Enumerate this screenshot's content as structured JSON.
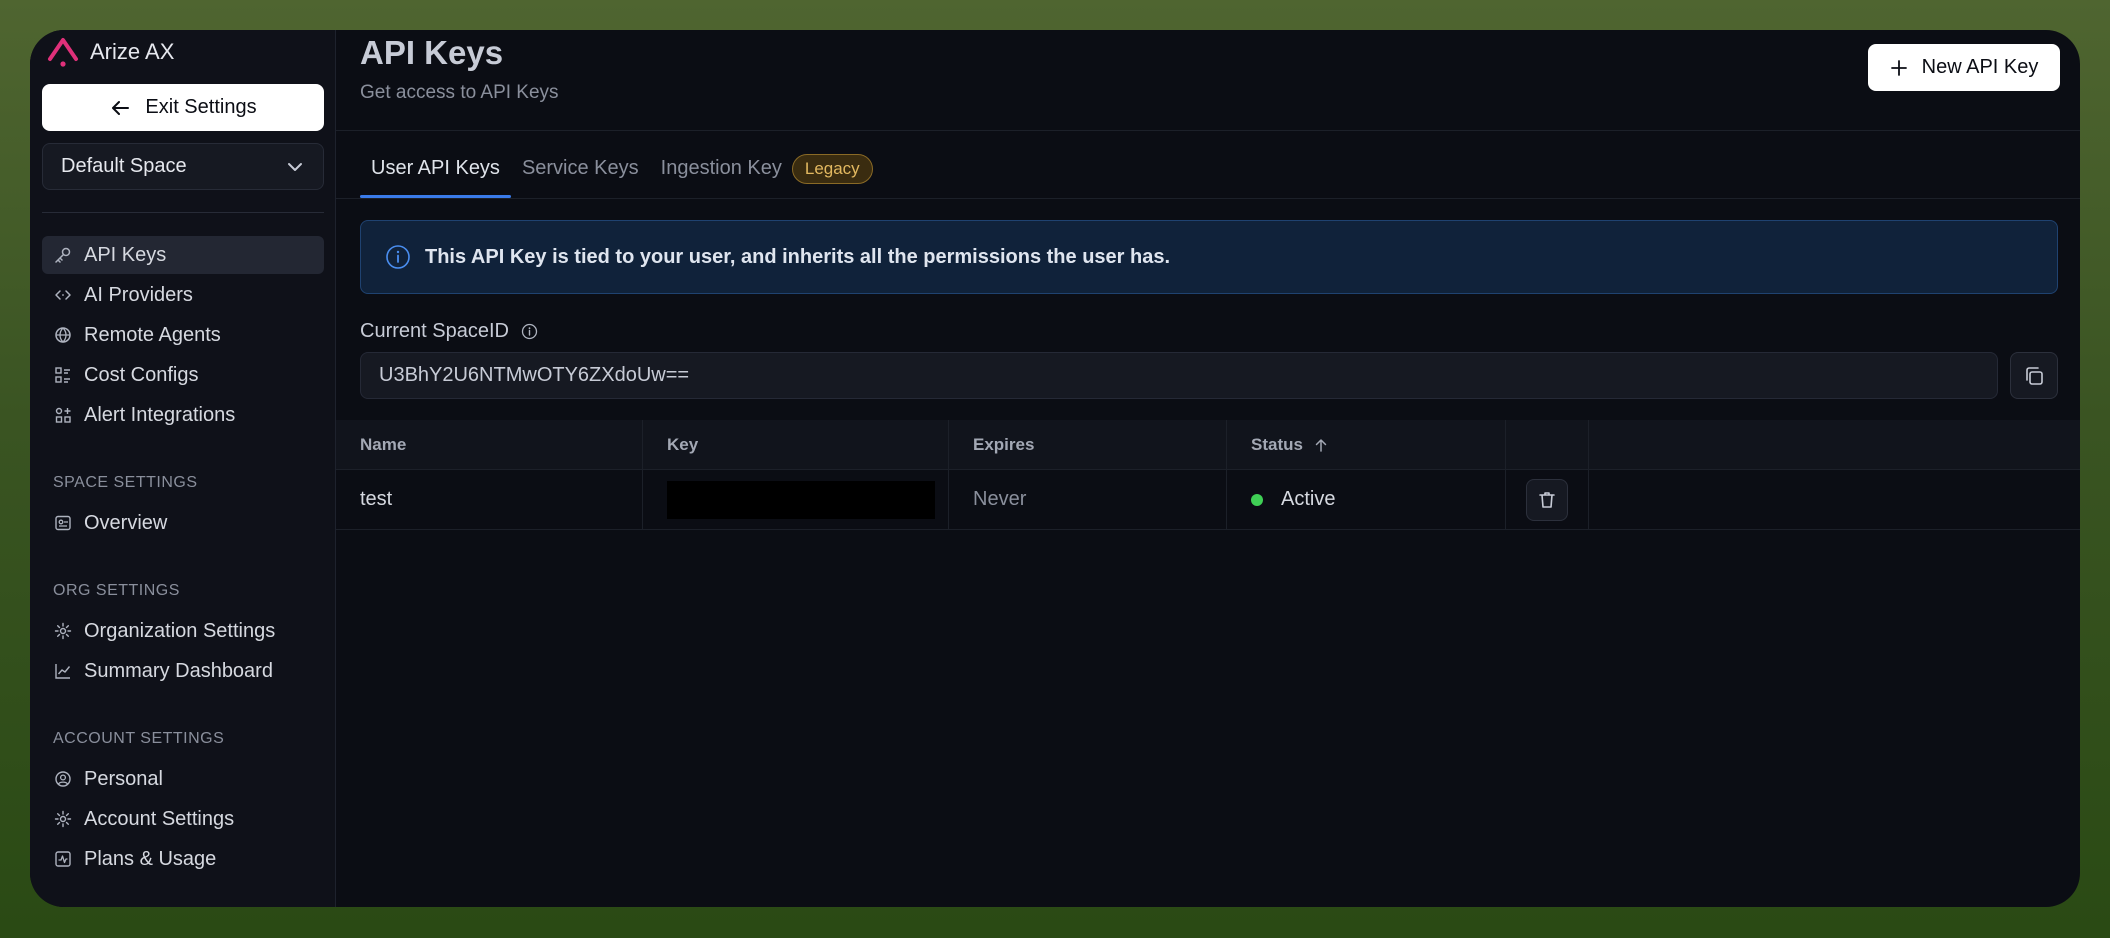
{
  "app": {
    "brand": "Arize AX",
    "brand_color": "#e0307a"
  },
  "sidebar": {
    "exit_label": "Exit Settings",
    "space_select": "Default Space",
    "items": [
      {
        "label": "API Keys",
        "icon": "key-icon",
        "active": true
      },
      {
        "label": "AI Providers",
        "icon": "code-arrows-icon"
      },
      {
        "label": "Remote Agents",
        "icon": "globe-icon"
      },
      {
        "label": "Cost Configs",
        "icon": "list-grid-icon"
      },
      {
        "label": "Alert Integrations",
        "icon": "integrations-icon"
      }
    ],
    "space_settings": {
      "heading": "SPACE SETTINGS",
      "items": [
        {
          "label": "Overview",
          "icon": "overview-icon"
        }
      ]
    },
    "org_settings": {
      "heading": "ORG SETTINGS",
      "items": [
        {
          "label": "Organization Settings",
          "icon": "gear-icon"
        },
        {
          "label": "Summary Dashboard",
          "icon": "chart-line-icon"
        }
      ]
    },
    "account_settings": {
      "heading": "ACCOUNT SETTINGS",
      "items": [
        {
          "label": "Personal",
          "icon": "user-circle-icon"
        },
        {
          "label": "Account Settings",
          "icon": "gear-icon"
        },
        {
          "label": "Plans & Usage",
          "icon": "activity-icon"
        }
      ]
    }
  },
  "main": {
    "title": "API Keys",
    "subtitle": "Get access to API Keys",
    "new_key_label": "New API Key",
    "tabs": [
      {
        "label": "User API Keys",
        "active": true
      },
      {
        "label": "Service Keys"
      },
      {
        "label": "Ingestion Key",
        "badge": "Legacy"
      }
    ],
    "info_banner": "This API Key is tied to your user, and inherits all the permissions the user has.",
    "space_id_label": "Current SpaceID",
    "space_id_value": "U3BhY2U6NTMwOTY6ZXdoUw==",
    "table": {
      "columns": [
        "Name",
        "Key",
        "Expires",
        "Status"
      ],
      "rows": [
        {
          "name": "test",
          "key": "",
          "expires": "Never",
          "status": "Active",
          "status_color": "#3fcf55"
        }
      ]
    }
  }
}
